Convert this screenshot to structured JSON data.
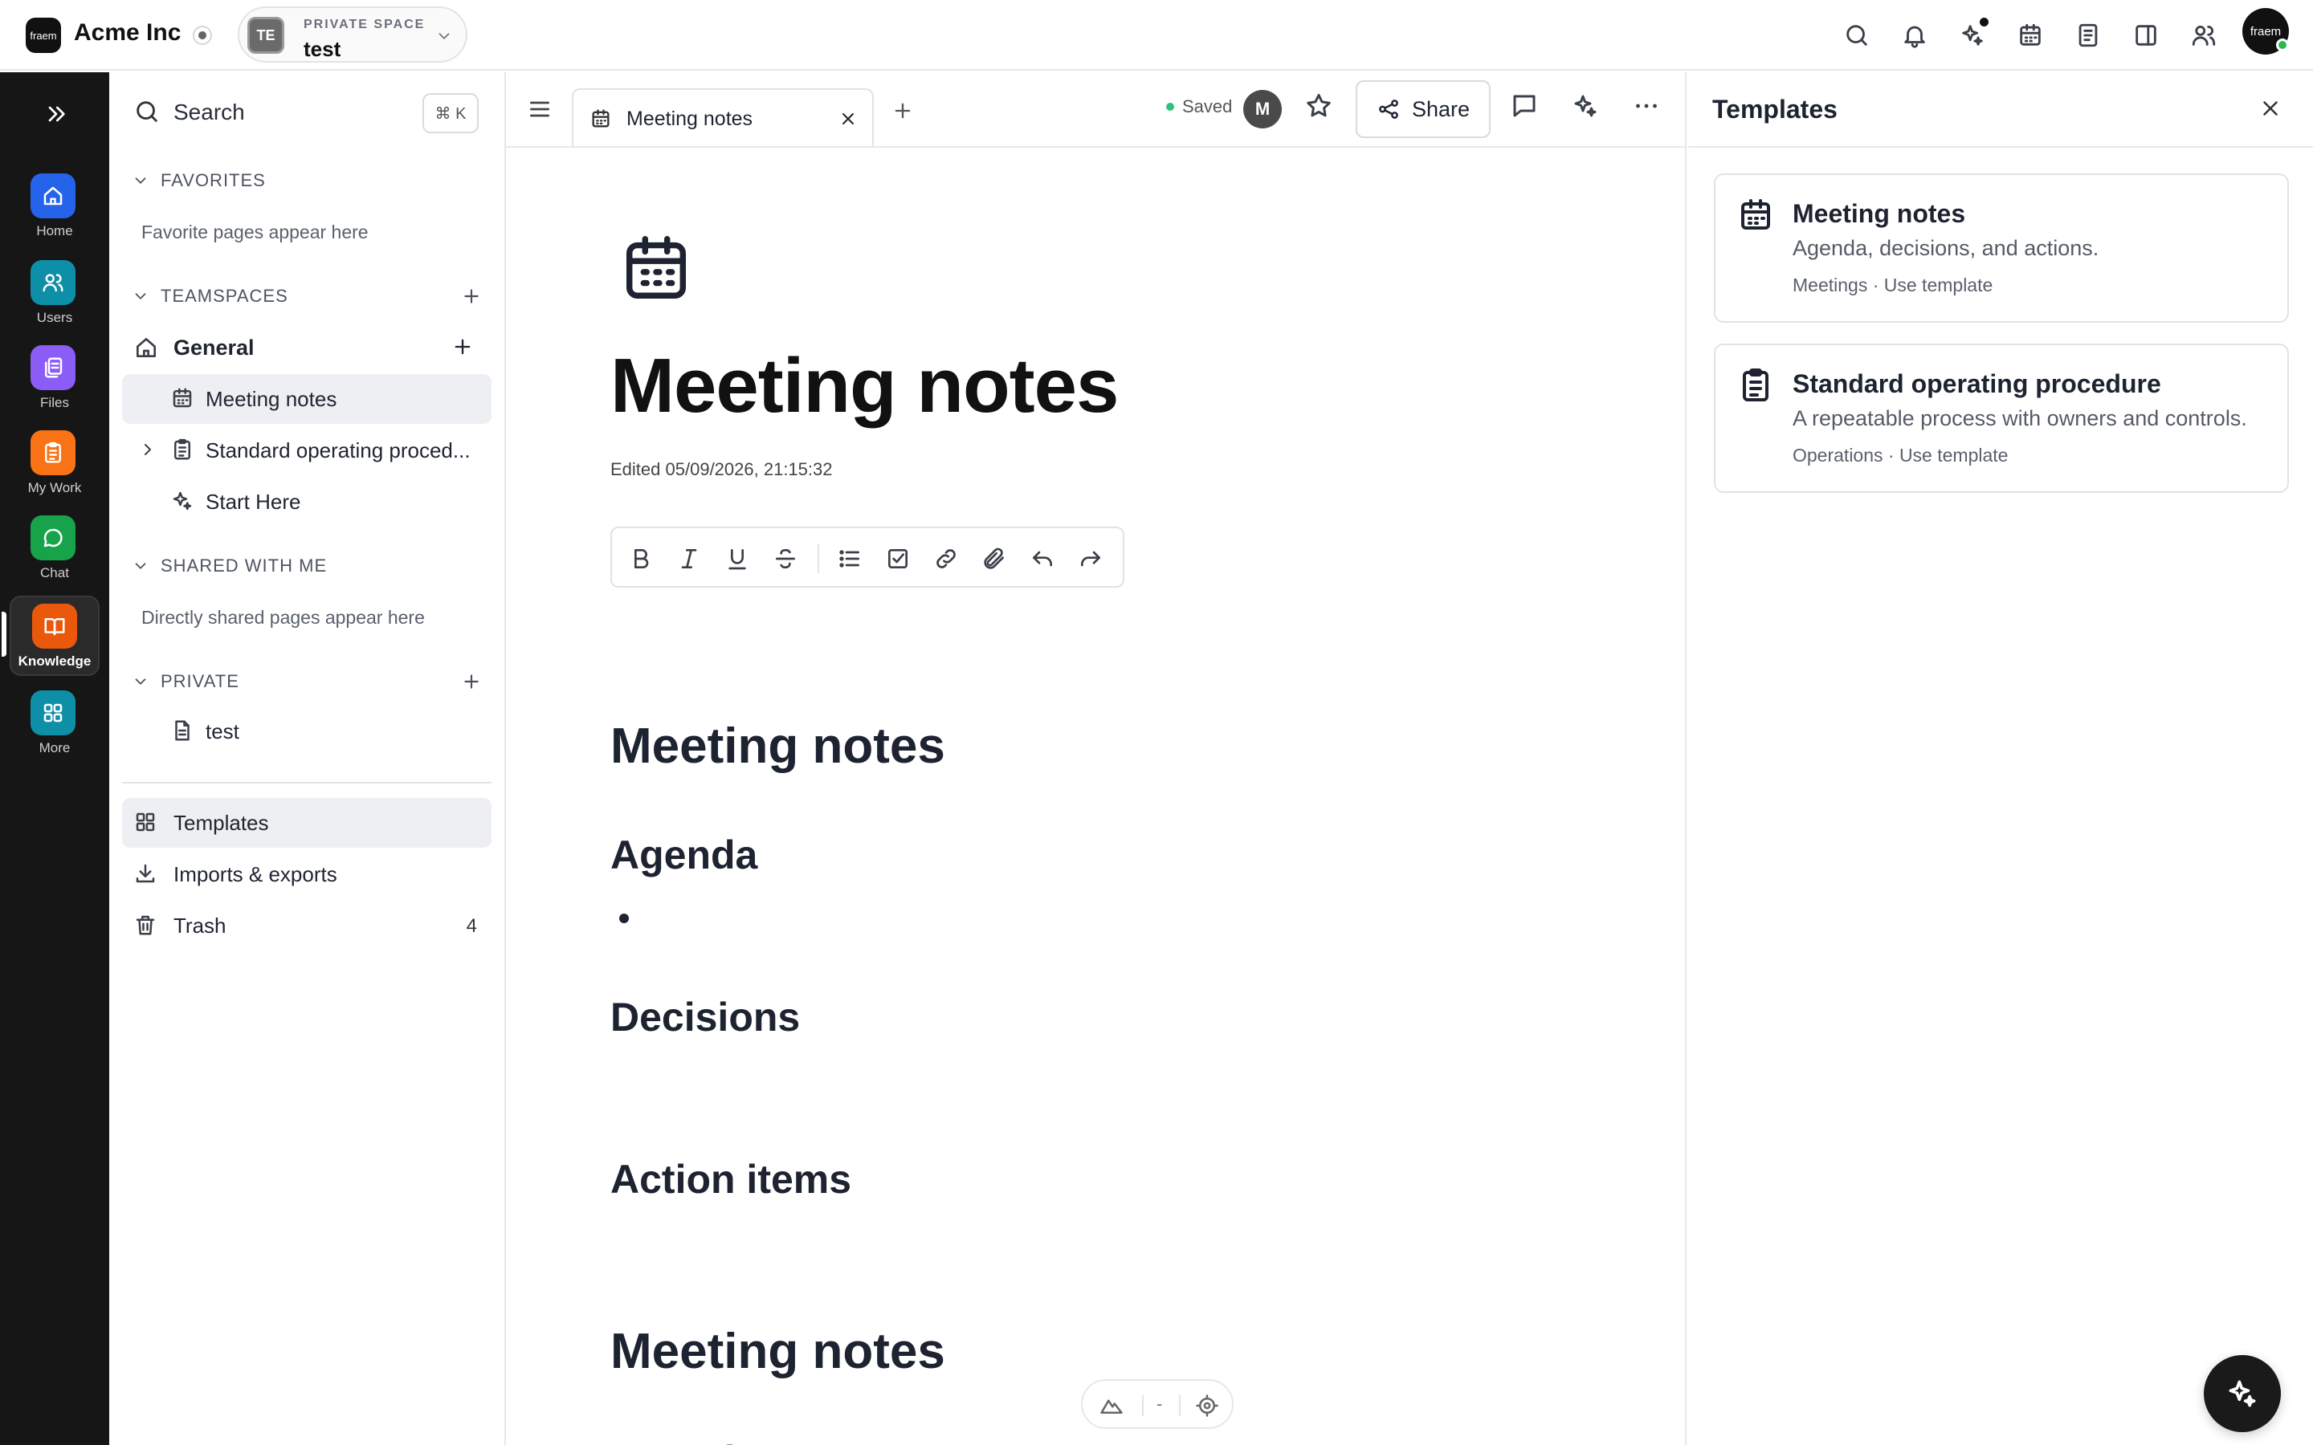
{
  "brand": {
    "name": "Acme Inc",
    "logo_text": "fraem"
  },
  "space": {
    "caption": "PRIVATE SPACE",
    "name": "test",
    "avatar_initials": "TE"
  },
  "user": {
    "avatar_text": "fraem"
  },
  "rail": {
    "items": [
      {
        "label": "Home",
        "icon": "home-icon",
        "color": "#2563eb"
      },
      {
        "label": "Users",
        "icon": "users-icon",
        "color": "#0e8fa8"
      },
      {
        "label": "Files",
        "icon": "files-icon",
        "color": "#8b5cf6"
      },
      {
        "label": "My Work",
        "icon": "clipboard-icon",
        "color": "#f97316"
      },
      {
        "label": "Chat",
        "icon": "chat-icon",
        "color": "#16a34a"
      },
      {
        "label": "Knowledge",
        "icon": "book-icon",
        "color": "#ea580c"
      },
      {
        "label": "More",
        "icon": "grid-icon",
        "color": "#0e8fa8"
      }
    ]
  },
  "sidebar": {
    "search_label": "Search",
    "search_shortcut": "⌘ K",
    "favorites": {
      "title": "FAVORITES",
      "empty": "Favorite pages appear here"
    },
    "teamspaces": {
      "title": "TEAMSPACES",
      "general": "General",
      "pages": [
        "Meeting notes",
        "Standard operating proced...",
        "Start Here"
      ]
    },
    "shared": {
      "title": "SHARED WITH ME",
      "empty": "Directly shared pages appear here"
    },
    "private": {
      "title": "PRIVATE",
      "pages": [
        "test"
      ]
    },
    "bottom": {
      "templates": "Templates",
      "imports": "Imports & exports",
      "trash": "Trash",
      "trash_count": "4"
    }
  },
  "editor": {
    "tab_label": "Meeting notes",
    "saved_label": "Saved",
    "collaborator_initial": "M",
    "share_label": "Share",
    "title": "Meeting notes",
    "edited_label": "Edited",
    "edited_at": "05/09/2026, 21:15:32",
    "blocks": {
      "h1_a": "Meeting notes",
      "agenda_a": "Agenda",
      "decisions": "Decisions",
      "action_items": "Action items",
      "h1_b": "Meeting notes",
      "agenda_b": "Agenda"
    },
    "bottom_pill_text": "-"
  },
  "templates": {
    "title": "Templates",
    "cards": [
      {
        "name": "Meeting notes",
        "desc": "Agenda, decisions, and actions.",
        "meta": "Meetings · Use template"
      },
      {
        "name": "Standard operating procedure",
        "desc": "A repeatable process with owners and controls.",
        "meta": "Operations · Use template"
      }
    ]
  }
}
